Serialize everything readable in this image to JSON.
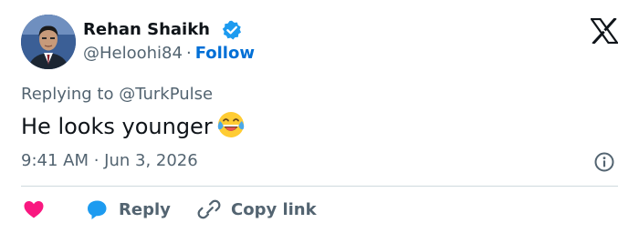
{
  "author": {
    "name": "Rehan Shaikh",
    "handle": "@Heloohi84",
    "separator": "·",
    "follow_label": "Follow",
    "verified": true
  },
  "reply_context": {
    "prefix": "Replying to ",
    "handle": "@TurkPulse"
  },
  "tweet": {
    "text": "He looks younger",
    "emoji": "face-with-tears-of-joy",
    "timestamp": "9:41 AM · Jun 3, 2026"
  },
  "actions": {
    "like_icon": "heart-icon",
    "reply_label": "Reply",
    "copy_label": "Copy link"
  },
  "icons": {
    "platform_logo": "x-logo-icon",
    "info": "info-icon"
  },
  "colors": {
    "text": "#0f1419",
    "secondary": "#536471",
    "link": "#006fd6",
    "verified": "#1d9bf0",
    "like": "#f91880",
    "reply": "#1d9bf0",
    "divider": "#cfd9de"
  }
}
